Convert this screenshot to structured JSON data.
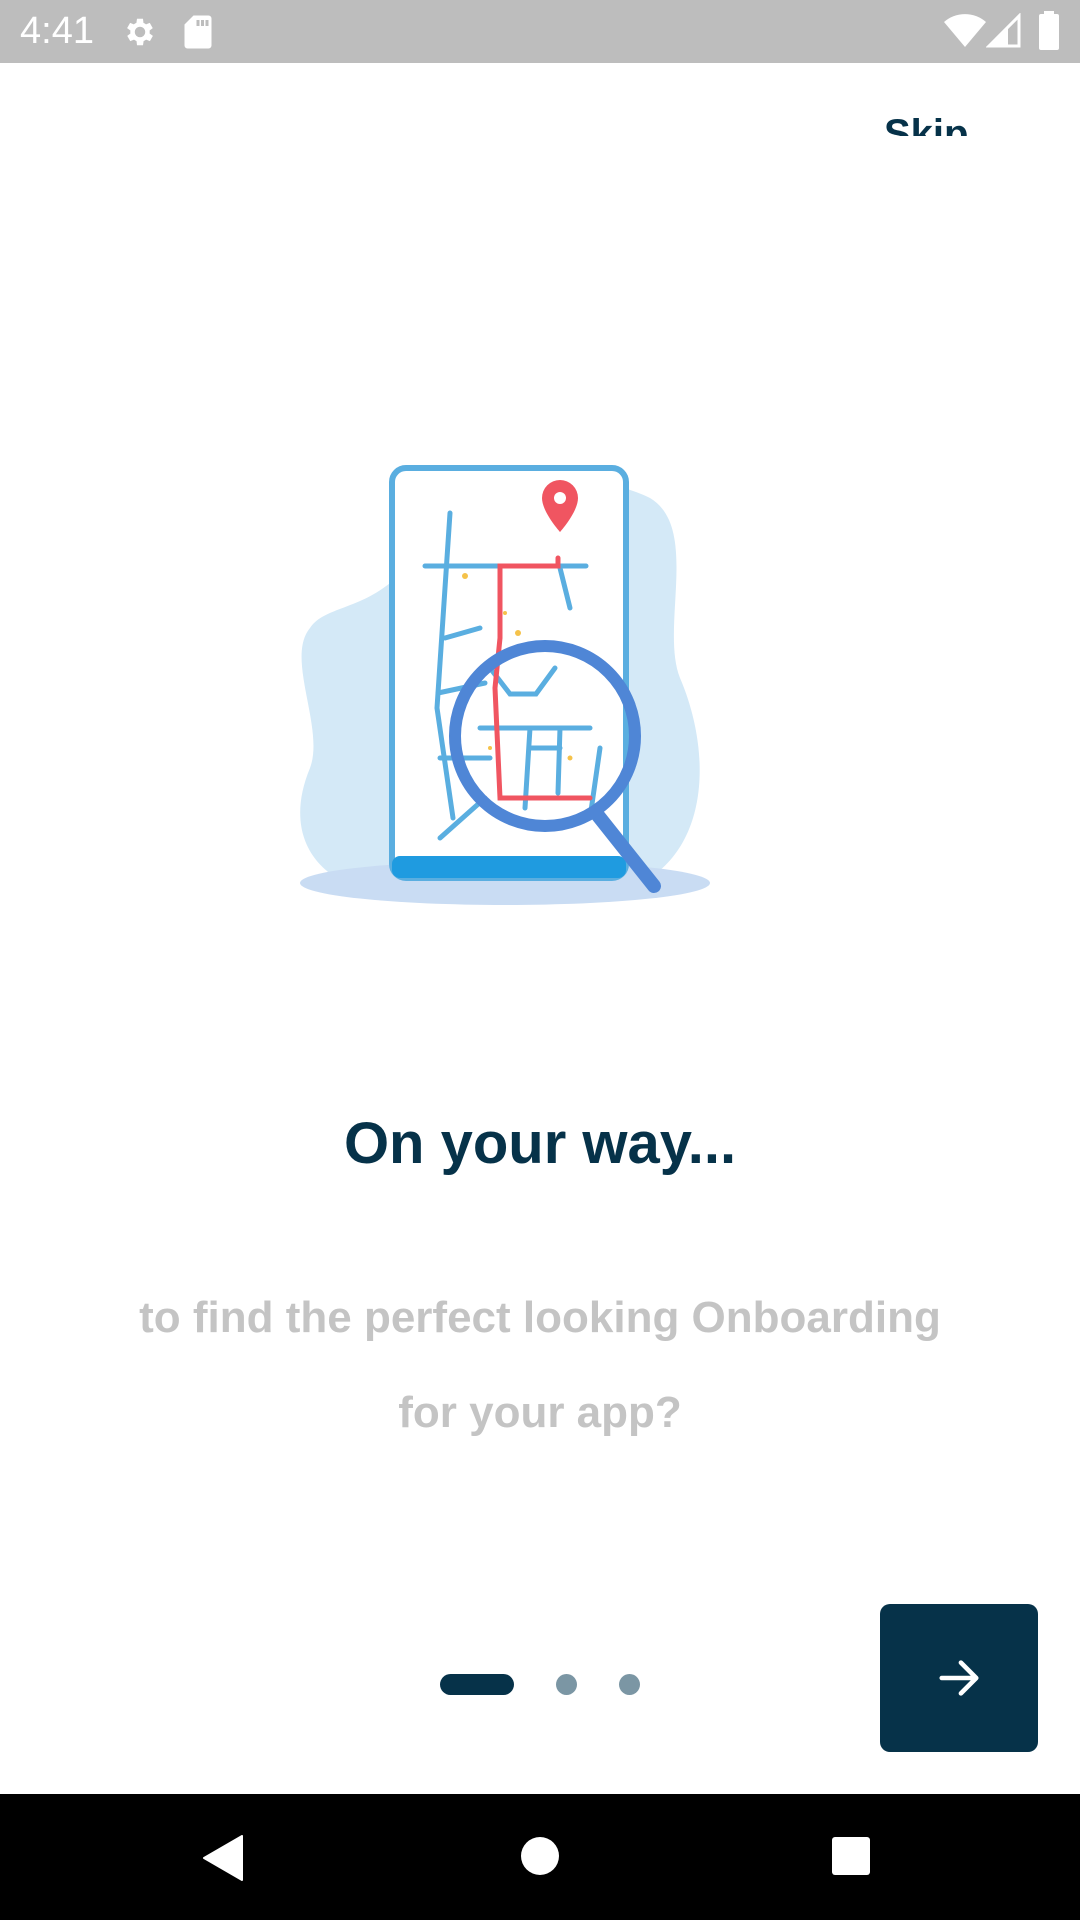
{
  "status_bar": {
    "time": "4:41",
    "icons": [
      "gear-icon",
      "sd-card-icon",
      "wifi-icon",
      "signal-icon",
      "battery-icon"
    ]
  },
  "onboarding": {
    "skip_label": "Skip",
    "title": "On your way...",
    "subtitle_line1": "to find the perfect looking Onboarding",
    "subtitle_line2": "for your app?",
    "page_indicator": {
      "total_pages": 3,
      "current_page": 1
    },
    "next_button_icon": "arrow-right-icon"
  },
  "navigation_bar": {
    "icons": [
      "back-icon",
      "home-icon",
      "recents-icon"
    ]
  },
  "colors": {
    "primary_dark": "#063249",
    "subtitle_gray": "#c4c4c4",
    "indicator_inactive": "#7b96a4",
    "status_bar_bg": "#bdbdbd",
    "illustration_blue": "#5aaee0",
    "illustration_red": "#f05561"
  }
}
